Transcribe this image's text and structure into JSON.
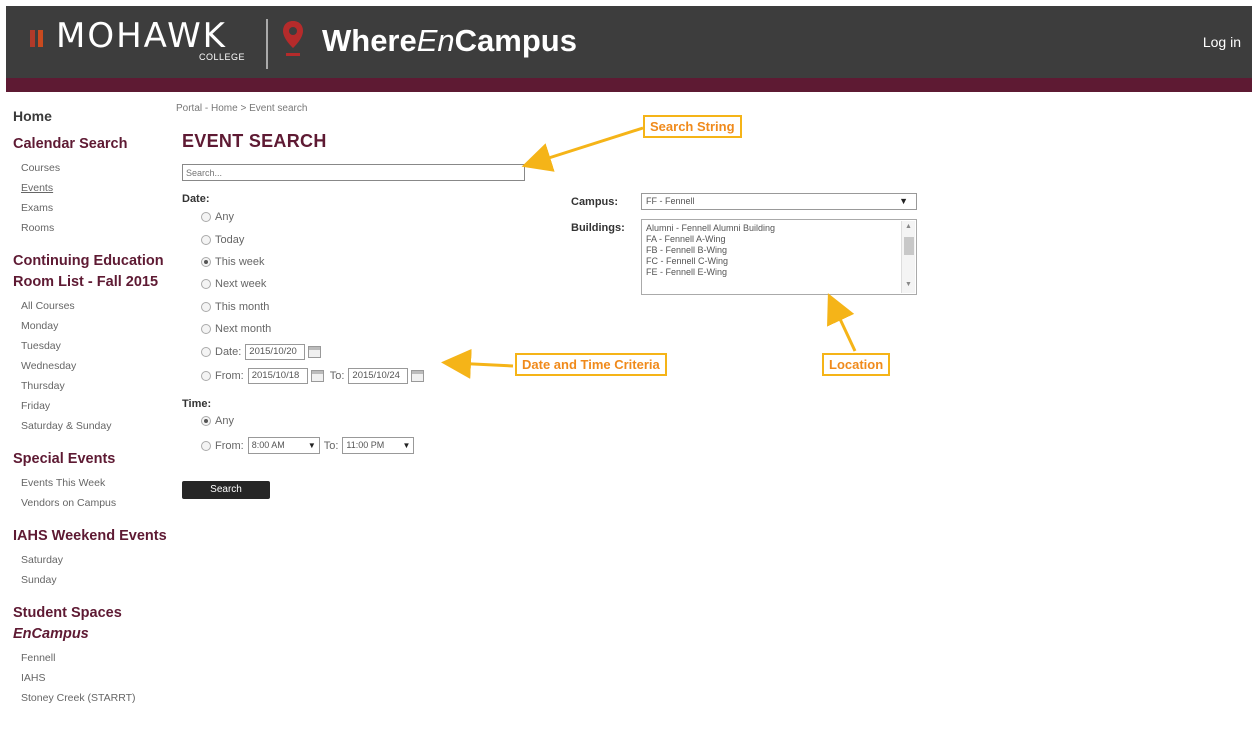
{
  "header": {
    "logo_text": "MOHAWK",
    "logo_sub": "COLLEGE",
    "brand_part1": "Where",
    "brand_part2": "En",
    "brand_part3": "Campus",
    "login_label": "Log in"
  },
  "sidebar": {
    "home": "Home",
    "sections": [
      {
        "title": "Calendar Search",
        "items": [
          "Courses",
          "Events",
          "Exams",
          "Rooms"
        ]
      },
      {
        "title": "Continuing Education Room List - Fall 2015",
        "items": [
          "All Courses",
          "Monday",
          "Tuesday",
          "Wednesday",
          "Thursday",
          "Friday",
          "Saturday & Sunday"
        ]
      },
      {
        "title": "Special Events",
        "items": [
          "Events This Week",
          "Vendors on Campus"
        ]
      },
      {
        "title": "IAHS Weekend Events",
        "items": [
          "Saturday",
          "Sunday"
        ]
      },
      {
        "title_line1": "Student Spaces",
        "title_line2": "EnCampus",
        "items": [
          "Fennell",
          "IAHS",
          "Stoney Creek (STARRT)"
        ]
      }
    ]
  },
  "main": {
    "breadcrumb": "Portal - Home > Event search",
    "title": "EVENT SEARCH",
    "search_placeholder": "Search...",
    "date_label": "Date:",
    "date_options": [
      "Any",
      "Today",
      "This week",
      "Next week",
      "This month",
      "Next month"
    ],
    "date_selected": "This week",
    "date_single_label": "Date:",
    "date_single_value": "2015/10/20",
    "from_label": "From:",
    "from_value": "2015/10/18",
    "to_label": "To:",
    "to_value": "2015/10/24",
    "time_label": "Time:",
    "time_any": "Any",
    "time_from_label": "From:",
    "time_from_value": "8:00 AM",
    "time_to_label": "To:",
    "time_to_value": "11:00 PM",
    "search_button": "Search",
    "campus_label": "Campus:",
    "campus_value": "FF - Fennell",
    "buildings_label": "Buildings:",
    "buildings": [
      "Alumni - Fennell Alumni Building",
      "FA - Fennell A-Wing",
      "FB - Fennell B-Wing",
      "FC - Fennell C-Wing",
      "FE - Fennell E-Wing"
    ]
  },
  "annotations": {
    "search_string": "Search String",
    "date_time": "Date and Time Criteria",
    "location": "Location",
    "color": "#f5b418"
  }
}
